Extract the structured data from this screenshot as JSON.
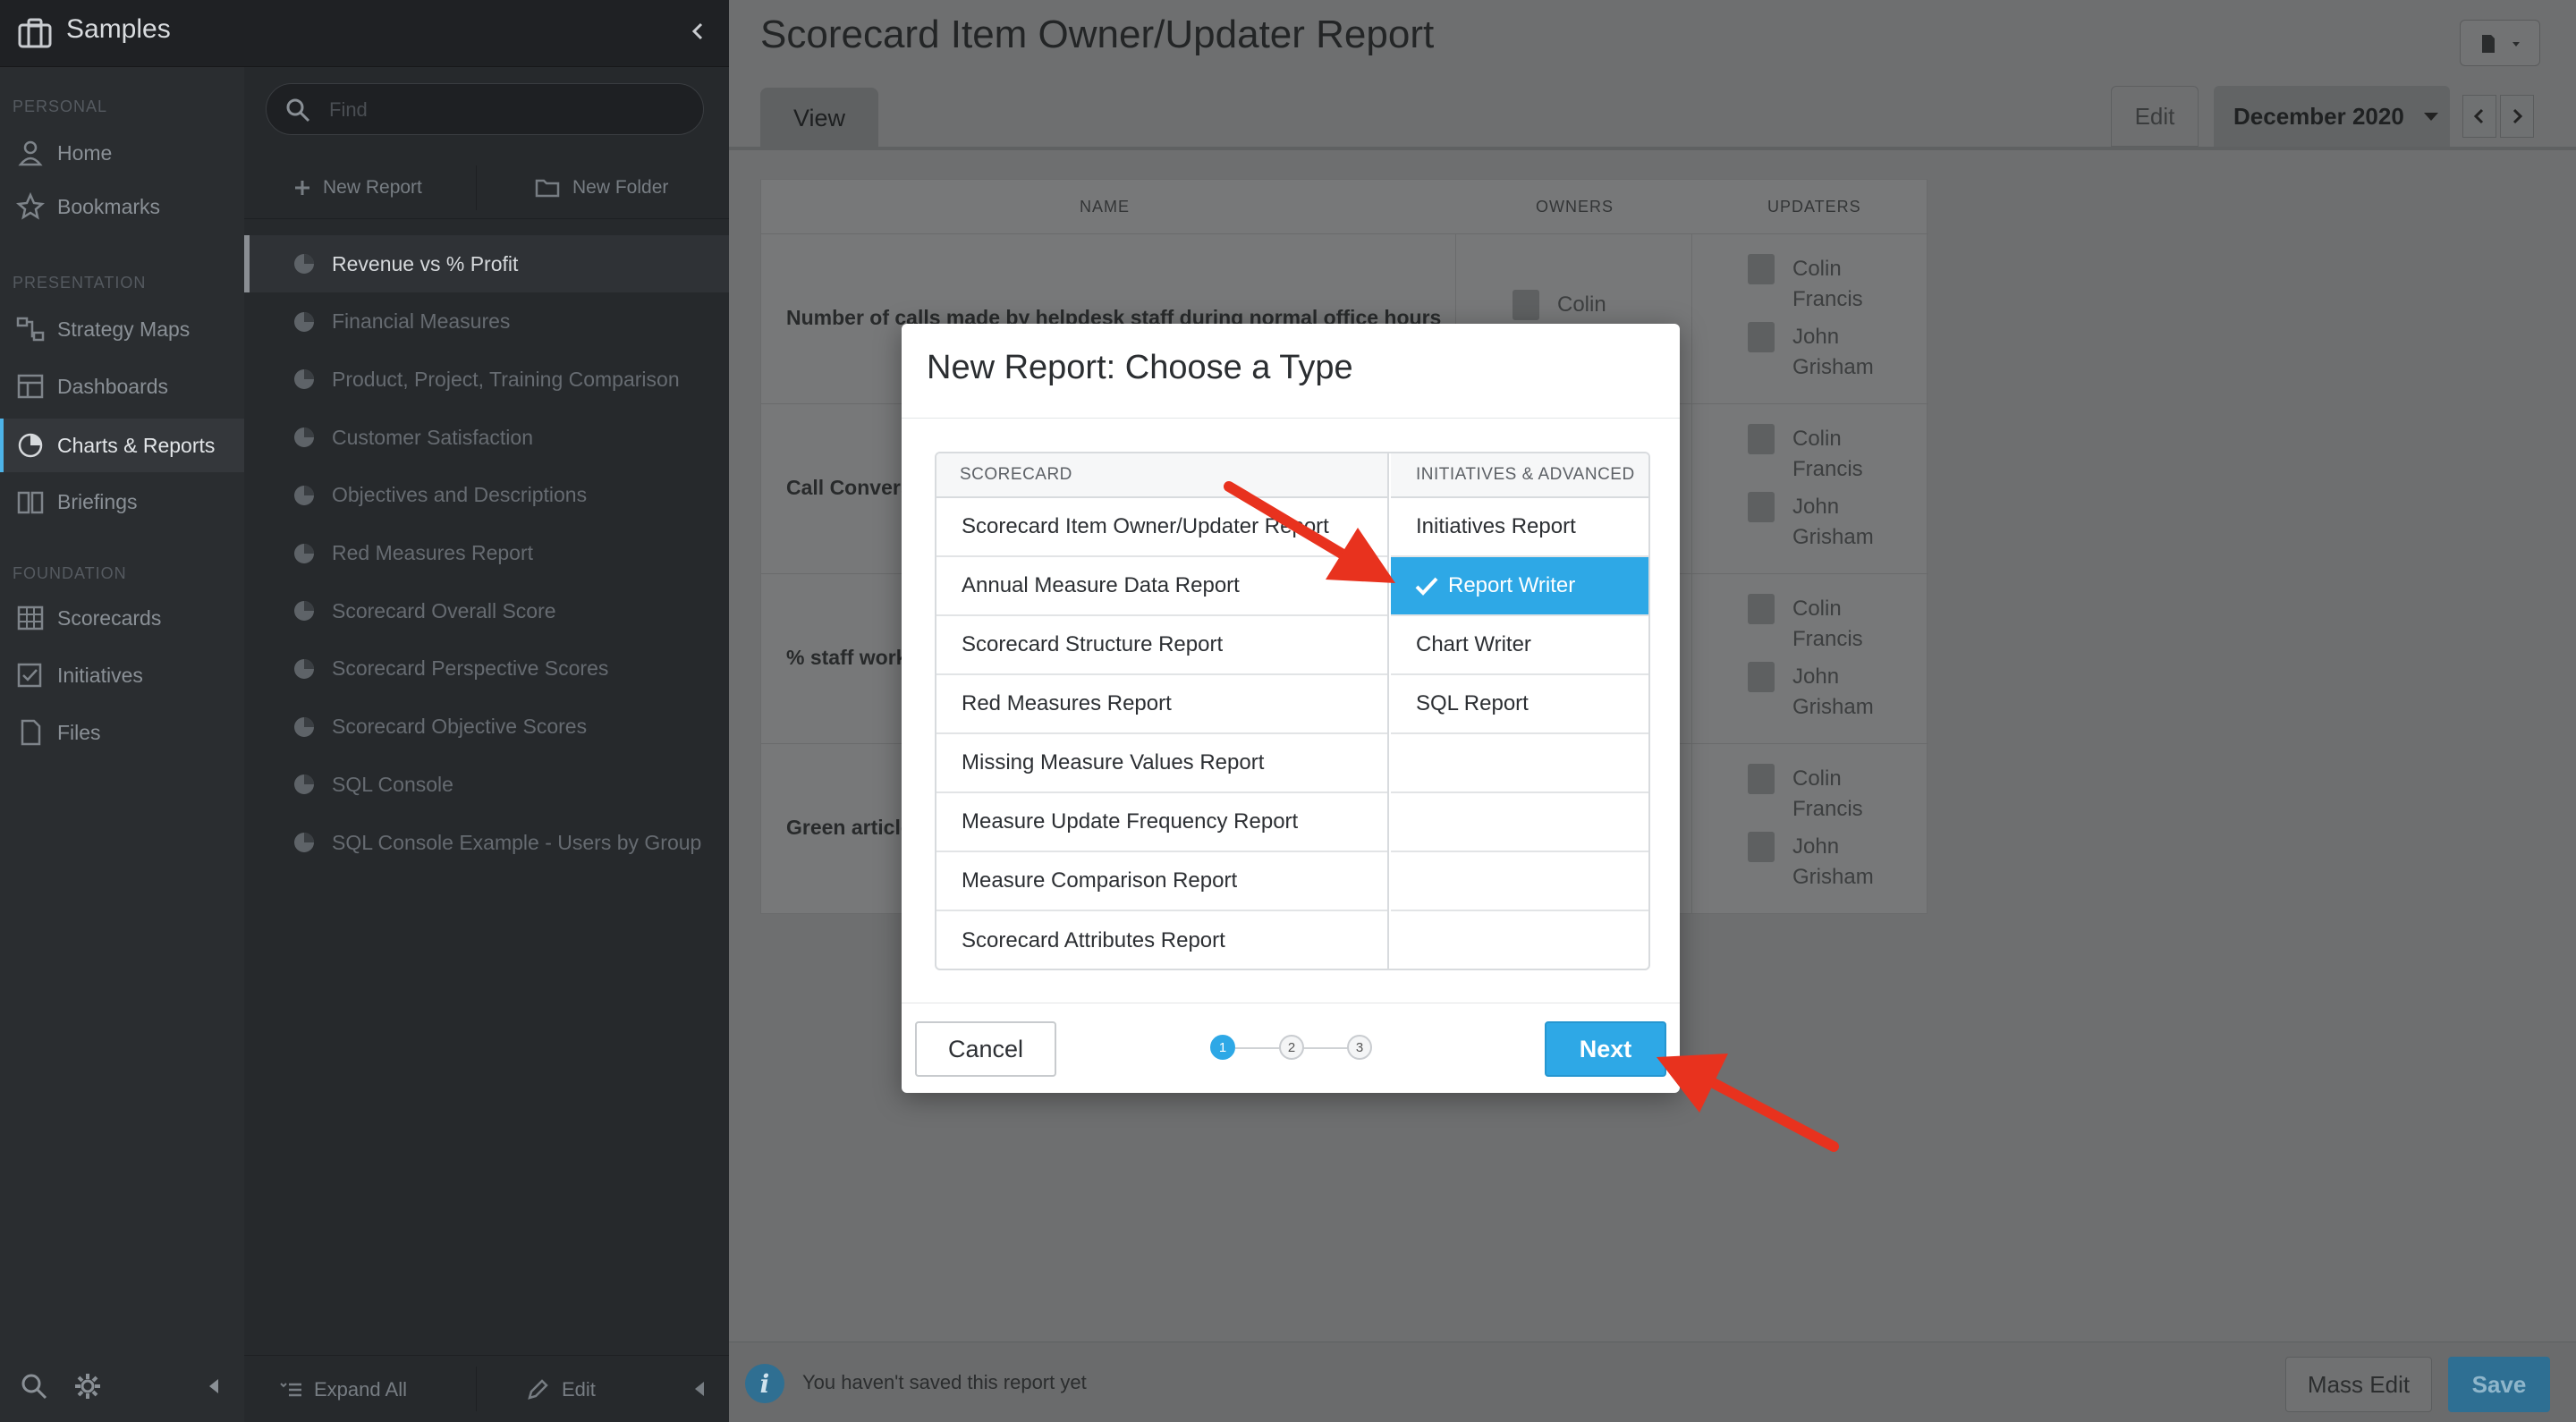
{
  "app": {
    "brand": "Samples"
  },
  "nav": {
    "sections": {
      "personal": "PERSONAL",
      "presentation": "PRESENTATION",
      "foundation": "FOUNDATION"
    },
    "items": [
      {
        "label": "Home",
        "icon": "person-icon"
      },
      {
        "label": "Bookmarks",
        "icon": "star-icon"
      },
      {
        "label": "Strategy Maps",
        "icon": "strategy-map-icon"
      },
      {
        "label": "Dashboards",
        "icon": "dashboard-icon"
      },
      {
        "label": "Charts & Reports",
        "icon": "pie-chart-icon",
        "active": true
      },
      {
        "label": "Briefings",
        "icon": "book-icon"
      },
      {
        "label": "Scorecards",
        "icon": "grid-icon"
      },
      {
        "label": "Initiatives",
        "icon": "checkbox-icon"
      },
      {
        "label": "Files",
        "icon": "file-icon"
      }
    ]
  },
  "panel": {
    "search_placeholder": "Find",
    "new_report": "New Report",
    "new_folder": "New Folder",
    "reports": [
      "Revenue vs % Profit",
      "Financial Measures",
      "Product, Project, Training Comparison",
      "Customer Satisfaction",
      "Objectives and Descriptions",
      "Red Measures Report",
      "Scorecard Overall Score",
      "Scorecard Perspective Scores",
      "Scorecard Objective Scores",
      "SQL Console",
      "SQL Console Example - Users by Group"
    ],
    "expand_all": "Expand All",
    "edit": "Edit"
  },
  "main": {
    "title": "Scorecard Item Owner/Updater Report",
    "tab_view": "View",
    "tab_edit": "Edit",
    "period": "December 2020",
    "table": {
      "headers": {
        "name": "NAME",
        "owners": "OWNERS",
        "updaters": "UPDATERS"
      },
      "rows": [
        {
          "name": "Number of calls made by helpdesk staff during normal office hours",
          "owner": "Colin",
          "updaters": [
            "Colin Francis",
            "John Grisham"
          ]
        },
        {
          "name": "Call Conversion",
          "owner": "",
          "updaters": [
            "Colin Francis",
            "John Grisham"
          ]
        },
        {
          "name": "% staff working",
          "owner": "",
          "updaters": [
            "Colin Francis",
            "John Grisham"
          ]
        },
        {
          "name": "Green articles",
          "owner": "",
          "updaters": [
            "Colin Francis",
            "John Grisham"
          ]
        }
      ]
    },
    "footer_msg": "You haven't saved this report yet",
    "mass_edit": "Mass Edit",
    "save": "Save"
  },
  "modal": {
    "title": "New Report: Choose a Type",
    "col_left_header": "SCORECARD",
    "col_right_header": "INITIATIVES & ADVANCED",
    "left_options": [
      "Scorecard Item Owner/Updater Report",
      "Annual Measure Data Report",
      "Scorecard Structure Report",
      "Red Measures Report",
      "Missing Measure Values Report",
      "Measure Update Frequency Report",
      "Measure Comparison Report",
      "Scorecard Attributes Report"
    ],
    "right_options": [
      "Initiatives Report",
      "Report Writer",
      "Chart Writer",
      "SQL Report"
    ],
    "selected": "Report Writer",
    "cancel": "Cancel",
    "next": "Next",
    "steps": [
      "1",
      "2",
      "3"
    ],
    "current_step": 1
  },
  "colors": {
    "accent": "#2ea8e6",
    "annotation_arrow": "#e8321e"
  }
}
